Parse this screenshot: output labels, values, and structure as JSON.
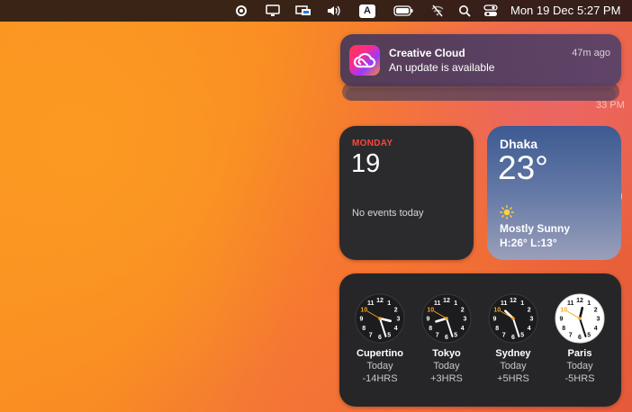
{
  "menubar": {
    "icons": [
      "focus-icon",
      "display-icon",
      "screen-share-icon",
      "volume-icon",
      "keyboard-input-icon",
      "battery-icon",
      "wifi-off-icon",
      "spotlight-search-icon",
      "control-center-icon"
    ],
    "input_source_label": "A",
    "date": "Mon 19 Dec",
    "time": "5:27 PM"
  },
  "notification": {
    "app": "Creative Cloud",
    "message": "An update is available",
    "time": "47m ago",
    "icon": "creative-cloud-icon"
  },
  "peek": {
    "time_text": "33 PM",
    "paren_text": ")"
  },
  "calendar_widget": {
    "month": "MONDAY",
    "day": "19",
    "events": "No events today"
  },
  "weather_widget": {
    "city": "Dhaka",
    "temperature": "23°",
    "condition": "Mostly Sunny",
    "high_low": "H:26° L:13°",
    "icon": "sun-icon"
  },
  "clock_widget": {
    "clocks": [
      {
        "city": "Cupertino",
        "day": "Today",
        "offset": "-14HRS",
        "face": "dark",
        "hour": 3,
        "minute": 27
      },
      {
        "city": "Tokyo",
        "day": "Today",
        "offset": "+3HRS",
        "face": "dark",
        "hour": 8,
        "minute": 27
      },
      {
        "city": "Sydney",
        "day": "Today",
        "offset": "+5HRS",
        "face": "dark",
        "hour": 10,
        "minute": 27
      },
      {
        "city": "Paris",
        "day": "Today",
        "offset": "-5HRS",
        "face": "light",
        "hour": 12,
        "minute": 27
      }
    ]
  },
  "colors": {
    "accent_red": "#ff453a",
    "second_hand": "#f5a623"
  }
}
